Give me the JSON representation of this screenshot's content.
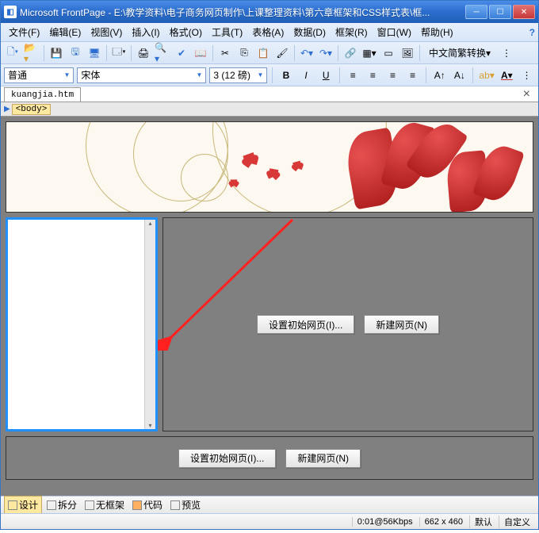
{
  "window": {
    "title": "Microsoft FrontPage - E:\\教学资料\\电子商务网页制作\\上课整理资料\\第六章框架和CSS样式表\\框..."
  },
  "menu": {
    "file": "文件(F)",
    "edit": "编辑(E)",
    "view": "视图(V)",
    "insert": "插入(I)",
    "format": "格式(O)",
    "tools": "工具(T)",
    "table": "表格(A)",
    "data": "数据(D)",
    "frame": "框架(R)",
    "window": "窗口(W)",
    "help": "帮助(H)"
  },
  "toolbar": {
    "cn_convert": "中文简繁转换"
  },
  "format": {
    "style": "普通",
    "font": "宋体",
    "size": "3 (12 磅)"
  },
  "tabs": {
    "file1": "kuangjia.htm"
  },
  "breadcrumb": {
    "body": "<body>"
  },
  "buttons": {
    "set_initial": "设置初始网页(I)...",
    "new_page": "新建网页(N)"
  },
  "viewbar": {
    "design": "设计",
    "split": "拆分",
    "noframe": "无框架",
    "code": "代码",
    "preview": "预览"
  },
  "status": {
    "speed": "0:01@56Kbps",
    "dims": "662 x 460",
    "default": "默认",
    "custom": "自定义"
  }
}
